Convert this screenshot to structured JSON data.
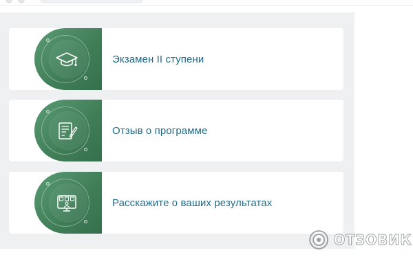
{
  "cards": [
    {
      "label": "Экзамен II ступени",
      "icon": "graduation-cap-icon"
    },
    {
      "label": "Отзыв о программе",
      "icon": "review-form-icon"
    },
    {
      "label": "Расскажите о ваших результатах",
      "icon": "presentation-screen-icon"
    }
  ],
  "watermark": {
    "text": "ОТЗОВИК"
  },
  "colors": {
    "accent_green": "#3f7d57",
    "label_blue": "#1f6a86",
    "panel_bg": "#eef0f1",
    "card_bg": "#ffffff"
  }
}
